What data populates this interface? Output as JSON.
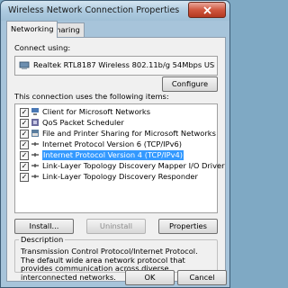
{
  "window": {
    "title": "Wireless Network Connection Properties"
  },
  "tabs": [
    {
      "label": "Networking",
      "active": true
    },
    {
      "label": "Sharing",
      "active": false
    }
  ],
  "connect_using": {
    "label": "Connect using:",
    "adapter": "Realtek RTL8187 Wireless 802.11b/g 54Mbps USB 2.0 N"
  },
  "configure_button": "Configure",
  "items_label": "This connection uses the following items:",
  "items": [
    {
      "label": "Client for Microsoft Networks",
      "checked": true,
      "icon": "network-client-icon"
    },
    {
      "label": "QoS Packet Scheduler",
      "checked": true,
      "icon": "qos-icon"
    },
    {
      "label": "File and Printer Sharing for Microsoft Networks",
      "checked": true,
      "icon": "file-printer-sharing-icon"
    },
    {
      "label": "Internet Protocol Version 6 (TCP/IPv6)",
      "checked": true,
      "icon": "protocol-icon"
    },
    {
      "label": "Internet Protocol Version 4 (TCP/IPv4)",
      "checked": true,
      "icon": "protocol-icon",
      "selected": true
    },
    {
      "label": "Link-Layer Topology Discovery Mapper I/O Driver",
      "checked": true,
      "icon": "protocol-icon"
    },
    {
      "label": "Link-Layer Topology Discovery Responder",
      "checked": true,
      "icon": "protocol-icon"
    }
  ],
  "buttons": {
    "install": "Install...",
    "uninstall": "Uninstall",
    "properties": "Properties",
    "ok": "OK",
    "cancel": "Cancel"
  },
  "description": {
    "title": "Description",
    "text": "Transmission Control Protocol/Internet Protocol. The default wide area network protocol that provides communication across diverse interconnected networks."
  },
  "colors": {
    "selection": "#3399ff",
    "close": "#c9452e"
  }
}
